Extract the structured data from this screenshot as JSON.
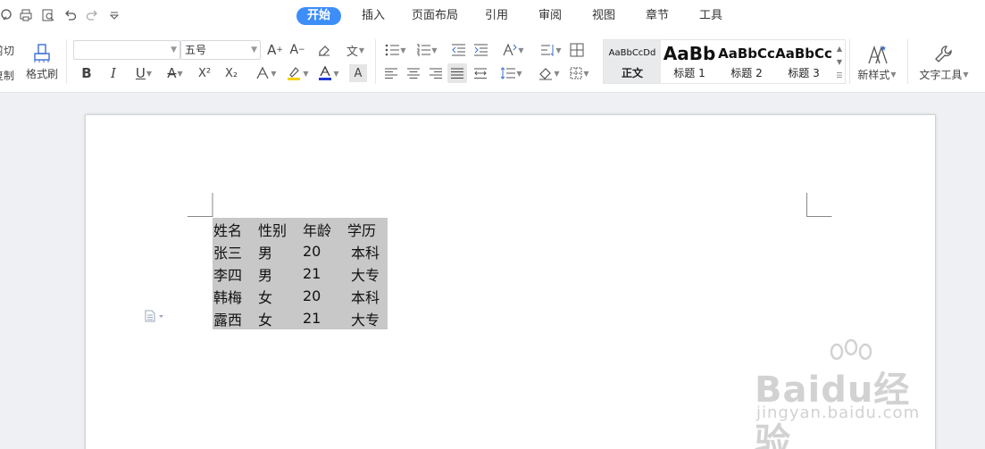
{
  "menu_tabs": [
    {
      "label": "开始",
      "active": true
    },
    {
      "label": "插入"
    },
    {
      "label": "页面布局"
    },
    {
      "label": "引用"
    },
    {
      "label": "审阅"
    },
    {
      "label": "视图"
    },
    {
      "label": "章节"
    },
    {
      "label": "工具"
    }
  ],
  "ribbon": {
    "cut_label": "剪切",
    "copy_label": "复制",
    "format_painter_label": "格式刷",
    "font_name_value": "",
    "font_size_value": "五号",
    "bold_label": "B",
    "italic_label": "I",
    "underline_label": "U",
    "strike_label": "A",
    "superscript_label": "X²",
    "subscript_label": "X₂",
    "new_style_label": "新样式",
    "text_tools_label": "文字工具"
  },
  "styles": [
    {
      "preview": "AaBbCcDd",
      "name": "正文",
      "selected": true
    },
    {
      "preview": "AaBb",
      "name": "标题 1"
    },
    {
      "preview": "AaBbCc",
      "name": "标题 2"
    },
    {
      "preview": "AaBbCc",
      "name": "标题 3"
    }
  ],
  "document": {
    "table": {
      "headers": [
        "姓名",
        "性别",
        "年龄",
        "学历"
      ],
      "rows": [
        [
          "张三",
          "男",
          "20",
          "本科"
        ],
        [
          "李四",
          "男",
          "21",
          "大专"
        ],
        [
          "韩梅",
          "女",
          "20",
          "本科"
        ],
        [
          "露西",
          "女",
          "21",
          "大专"
        ]
      ]
    }
  },
  "watermark": {
    "brand": "Baidu经验",
    "url": "jingyan.baidu.com"
  },
  "colors": {
    "accent": "#3d8ef8",
    "highlight": "#c8c8c8",
    "font_color_bar": "#1f3bd6",
    "highlight_bar": "#f5d000"
  }
}
